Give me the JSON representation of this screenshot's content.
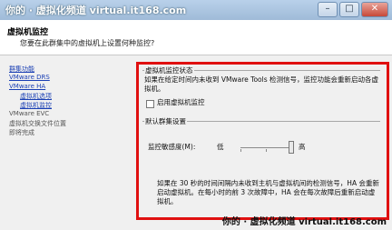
{
  "window": {
    "title": "你的 · 虚拟化频道 virtual.it168.com",
    "controls": [
      "minimize-icon",
      "maximize-icon",
      "close-icon"
    ]
  },
  "header": {
    "title": "虚拟机监控",
    "subtitle": "您要在此群集中的虚拟机上设置何种监控?"
  },
  "sidebar": {
    "items": [
      {
        "label": "群集功能",
        "link": true
      },
      {
        "label": "VMware DRS",
        "link": true
      },
      {
        "label": "VMware HA",
        "link": true
      },
      {
        "label": "虚拟机选项",
        "link": true
      },
      {
        "label": "虚拟机监控",
        "link": true
      },
      {
        "label": "VMware EVC",
        "link": false
      },
      {
        "label": "虚拟机交换文件位置",
        "link": false
      },
      {
        "label": "即将完成",
        "link": false
      }
    ]
  },
  "monitoring": {
    "section_title": "虚拟机监控状态",
    "description": "如果在给定时间内未收到 VMware Tools 检测信号，监控功能会重新启动各虚拟机。",
    "enable_checkbox_label": "启用虚拟机监控",
    "enabled": false
  },
  "defaults": {
    "section_title": "默认群集设置",
    "sensitivity_label": "监控敏感度(M):",
    "low_label": "低",
    "high_label": "高",
    "sensitivity_level": 1.0,
    "description": "如果在 30 秒的时间间隔内未收到主机与虚拟机间的检测信号，HA 会重新启动虚拟机。在每小时的前 3 次故障中，HA 会在每次故障后重新启动虚拟机。"
  },
  "watermark": {
    "text": "你的 · 虚拟化频道 virtual.it168.com"
  },
  "colors": {
    "highlight_border": "#e01010",
    "link": "#1a3fb4"
  }
}
